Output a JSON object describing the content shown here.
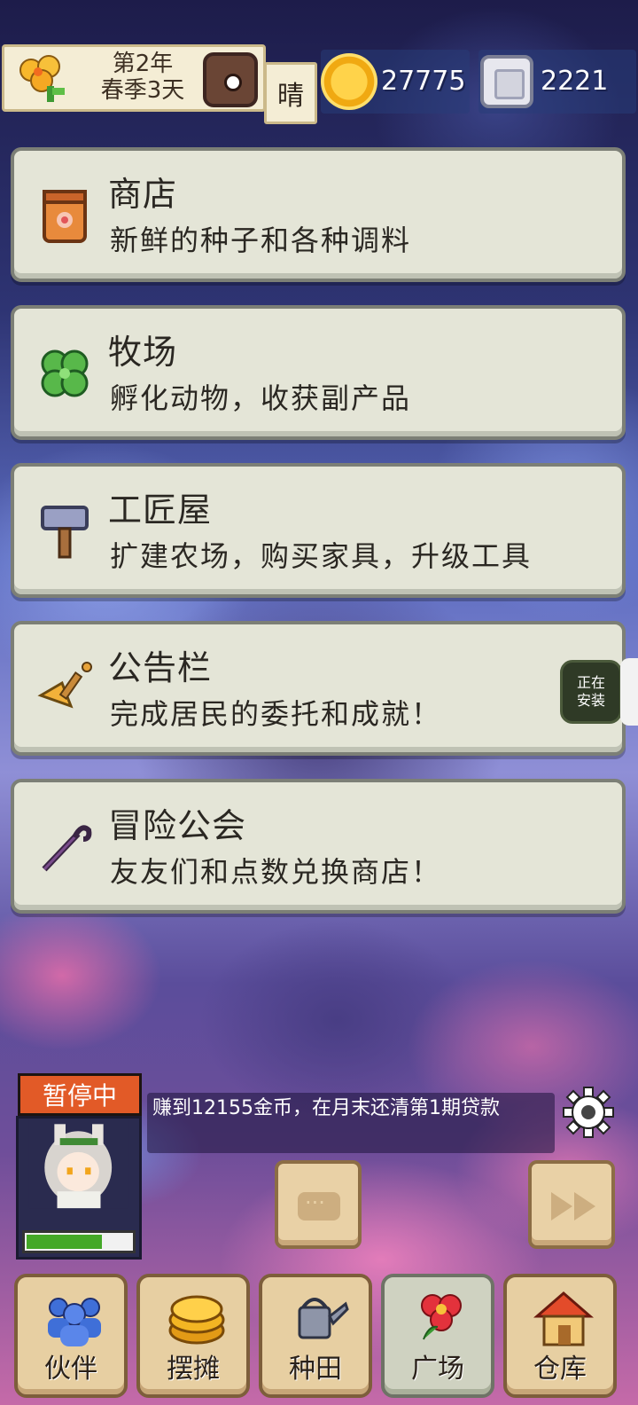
{
  "status": {
    "date_line1": "第2年",
    "date_line2": "春季3天",
    "weather": "晴",
    "gold": "27775",
    "silver": "2221"
  },
  "menu": [
    {
      "title": "商店",
      "desc": "新鲜的种子和各种调料",
      "icon": "seed-bag-icon"
    },
    {
      "title": "牧场",
      "desc": "孵化动物，收获副产品",
      "icon": "clover-icon"
    },
    {
      "title": "工匠屋",
      "desc": "扩建农场，购买家具，升级工具",
      "icon": "hammer-icon"
    },
    {
      "title": "公告栏",
      "desc": "完成居民的委托和成就！",
      "icon": "horn-icon"
    },
    {
      "title": "冒险公会",
      "desc": "友友们和点数兑换商店！",
      "icon": "staff-icon"
    }
  ],
  "install_badge": {
    "line1": "正在",
    "line2": "安装"
  },
  "character": {
    "pause_label": "暂停中",
    "stamina_fraction": 0.72
  },
  "quest": "赚到12155金币，在月末还清第1期贷款",
  "nav": [
    {
      "label": "伙伴",
      "icon": "people-icon"
    },
    {
      "label": "摆摊",
      "icon": "coins-icon"
    },
    {
      "label": "种田",
      "icon": "watering-can-icon"
    },
    {
      "label": "广场",
      "icon": "flower-icon",
      "active": true
    },
    {
      "label": "仓库",
      "icon": "house-icon"
    }
  ],
  "colors": {
    "card_bg": "#e4e5d7",
    "pause_badge": "#e25a27",
    "stamina": "#44a827",
    "nav_bg": "#e7cfa2"
  }
}
